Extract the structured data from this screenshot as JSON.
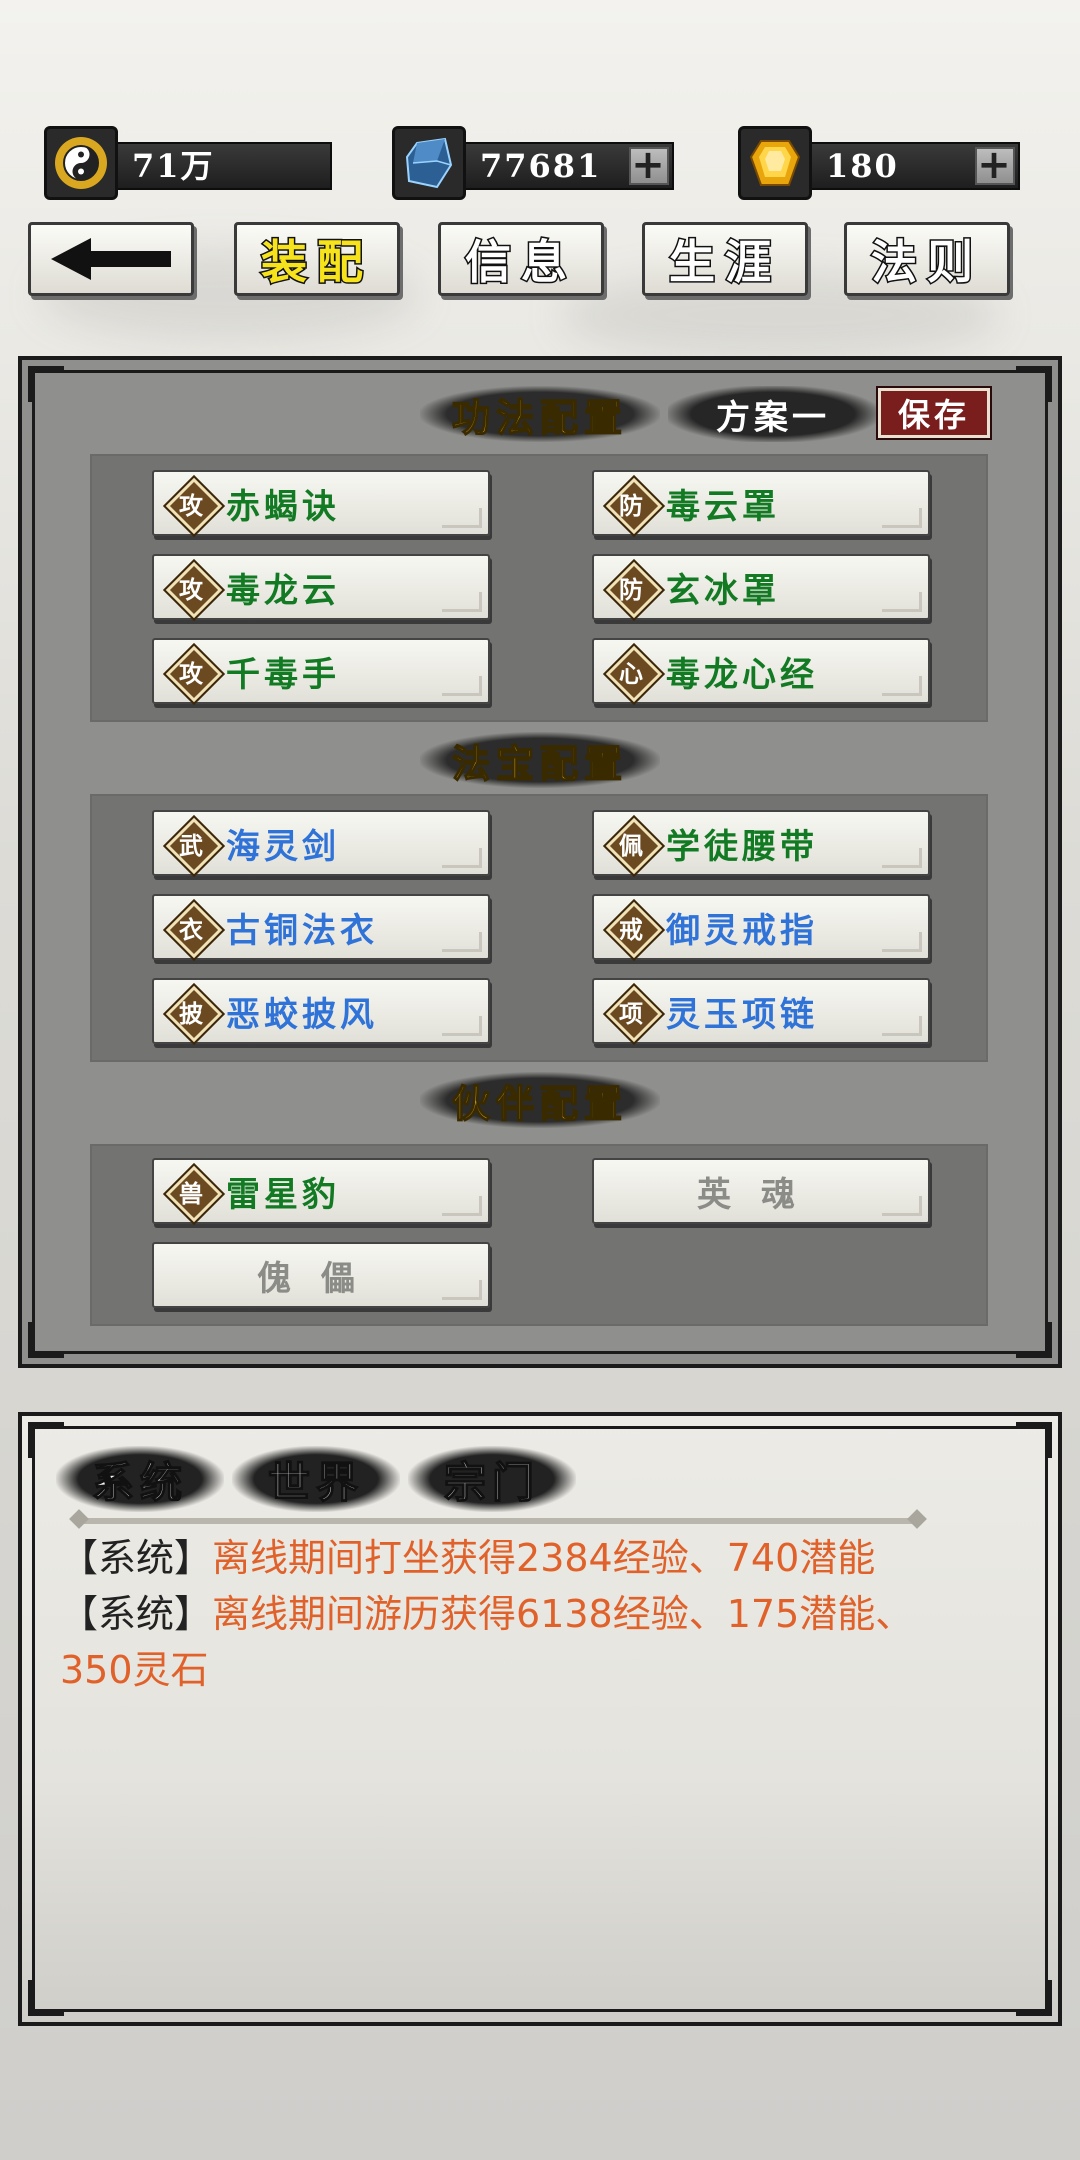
{
  "currency": [
    {
      "icon": "yin-yang-icon",
      "value": "71万"
    },
    {
      "icon": "blue-crystal-icon",
      "value": "77681"
    },
    {
      "icon": "gold-ingot-icon",
      "value": "180"
    }
  ],
  "nav": {
    "back_icon": "back-arrow-icon",
    "tabs": [
      "装配",
      "信息",
      "生涯",
      "法则"
    ]
  },
  "techniques": {
    "title": "功法配置",
    "scheme": "方案一",
    "save": "保存",
    "slots": [
      {
        "tag": "攻",
        "name": "赤蝎诀"
      },
      {
        "tag": "防",
        "name": "毒云罩"
      },
      {
        "tag": "攻",
        "name": "毒龙云"
      },
      {
        "tag": "防",
        "name": "玄冰罩"
      },
      {
        "tag": "攻",
        "name": "千毒手"
      },
      {
        "tag": "心",
        "name": "毒龙心经"
      }
    ]
  },
  "treasures": {
    "title": "法宝配置",
    "slots": [
      {
        "tag": "武",
        "name": "海灵剑"
      },
      {
        "tag": "佩",
        "name": "学徒腰带"
      },
      {
        "tag": "衣",
        "name": "古铜法衣"
      },
      {
        "tag": "戒",
        "name": "御灵戒指"
      },
      {
        "tag": "披",
        "name": "恶蛟披风"
      },
      {
        "tag": "项",
        "name": "灵玉项链"
      }
    ]
  },
  "partners": {
    "title": "伙伴配置",
    "slots": [
      {
        "tag": "兽",
        "name": "雷星豹"
      },
      {
        "name": "英魂"
      },
      {
        "name": "傀儡"
      }
    ]
  },
  "chat": {
    "tabs": [
      "系统",
      "世界",
      "宗门"
    ],
    "messages": [
      {
        "channel": "【系统】",
        "text": "离线期间打坐获得2384经验、740潜能"
      },
      {
        "channel": "【系统】",
        "text": "离线期间游历获得6138经验、175潜能、350灵石"
      }
    ]
  }
}
